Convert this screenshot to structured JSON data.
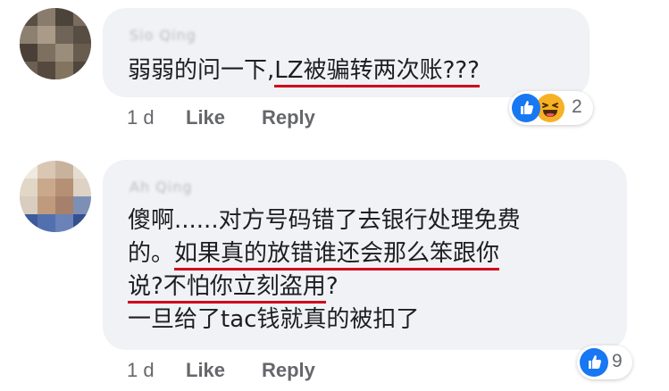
{
  "comments": [
    {
      "author": "Sio Qing",
      "text_lines": [
        [
          {
            "text": "弱弱的问一下,",
            "underline": false
          },
          {
            "text": "LZ被骗转两次账???",
            "underline": true
          }
        ]
      ],
      "actions": {
        "age": "1 d",
        "like": "Like",
        "reply": "Reply"
      },
      "reactions": {
        "icons": [
          "like-icon",
          "haha-icon"
        ],
        "count": "2"
      }
    },
    {
      "author": "Ah Qing",
      "text_lines": [
        [
          {
            "text": "傻啊......对方号码错了去银行处理免费",
            "underline": false
          }
        ],
        [
          {
            "text": "的。",
            "underline": false
          },
          {
            "text": "如果真的放错谁还会那么笨跟你",
            "underline": true
          }
        ],
        [
          {
            "text": "说?不怕你立刻盗用",
            "underline": true
          },
          {
            "text": "?",
            "underline": false
          }
        ],
        [
          {
            "text": "一旦给了tac钱就真的被扣了",
            "underline": false
          }
        ]
      ],
      "actions": {
        "age": "1 d",
        "like": "Like",
        "reply": "Reply"
      },
      "reactions": {
        "icons": [
          "like-icon"
        ],
        "count": "9"
      }
    }
  ],
  "colors": {
    "bubble": "#f0f2f5",
    "underline": "#d0021b",
    "like_blue": "#1877f2",
    "haha_yellow": "#f7b125",
    "meta_text": "#65676b",
    "body_text": "#1c1e21"
  }
}
